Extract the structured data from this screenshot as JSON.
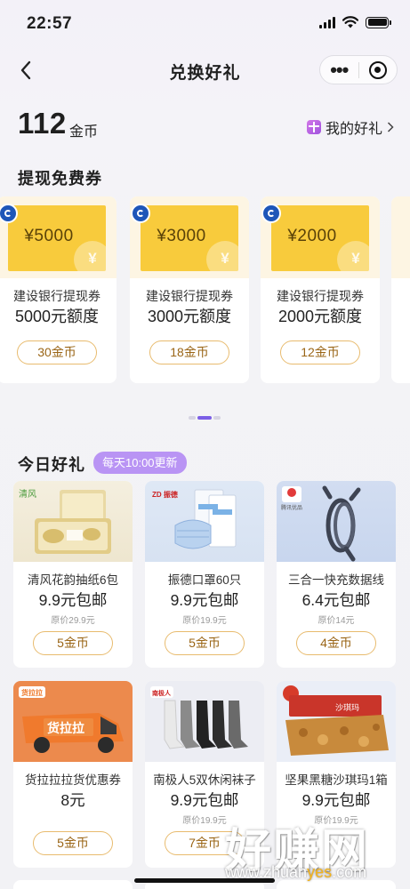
{
  "status_bar": {
    "time": "22:57"
  },
  "nav": {
    "title": "兑换好礼"
  },
  "wallet": {
    "amount": "112",
    "unit": "金币",
    "my_gifts_label": "我的好礼"
  },
  "withdraw_section": {
    "title": "提现免费券",
    "vouchers": [
      {
        "amount": "¥5000",
        "name": "建设银行提现券",
        "quota": "5000元额度",
        "cost": "30金币"
      },
      {
        "amount": "¥3000",
        "name": "建设银行提现券",
        "quota": "3000元额度",
        "cost": "18金币"
      },
      {
        "amount": "¥2000",
        "name": "建设银行提现券",
        "quota": "2000元额度",
        "cost": "12金币"
      }
    ]
  },
  "today_section": {
    "title": "今日好礼",
    "tag": "每天10:00更新",
    "products": [
      {
        "name": "清风花韵抽纸6包",
        "price": "9.9元包邮",
        "original": "原价29.9元",
        "cost": "5金币"
      },
      {
        "name": "振德口罩60只",
        "price": "9.9元包邮",
        "original": "原价19.9元",
        "cost": "5金币"
      },
      {
        "name": "三合一快充数据线",
        "price": "6.4元包邮",
        "original": "原价14元",
        "cost": "4金币"
      },
      {
        "name": "货拉拉拉货优惠券",
        "price": "8元",
        "original": "",
        "cost": "5金币"
      },
      {
        "name": "南极人5双休闲袜子",
        "price": "9.9元包邮",
        "original": "原价19.9元",
        "cost": "7金币"
      },
      {
        "name": "坚果黑糖沙琪玛1箱",
        "price": "9.9元包邮",
        "original": "原价19.9元",
        "cost": ""
      }
    ]
  },
  "image_labels": {
    "tissue_brand": "清风",
    "mask_brand": "ZD 振德",
    "cable_brand": "腾讯优品",
    "van_brand": "货拉拉",
    "van_text": "货拉拉",
    "socks_brand": "南极人",
    "snack_text": "沙琪玛"
  },
  "watermark": {
    "text": "好赚网",
    "url_prefix": "www.zhuan",
    "url_highlight": "yes",
    "url_suffix": ".com"
  },
  "colors": {
    "accent_purple": "#7b5ee6",
    "tag_purple": "#b994f4",
    "coin_gold": "#e8bb6e",
    "voucher_yellow": "#f8cb3c",
    "bank_blue": "#1e56b8"
  },
  "icons": [
    "back-arrow-icon",
    "more-dots-icon",
    "target-icon",
    "gift-box-icon",
    "chevron-right-icon",
    "bank-logo-icon",
    "yen-icon"
  ]
}
